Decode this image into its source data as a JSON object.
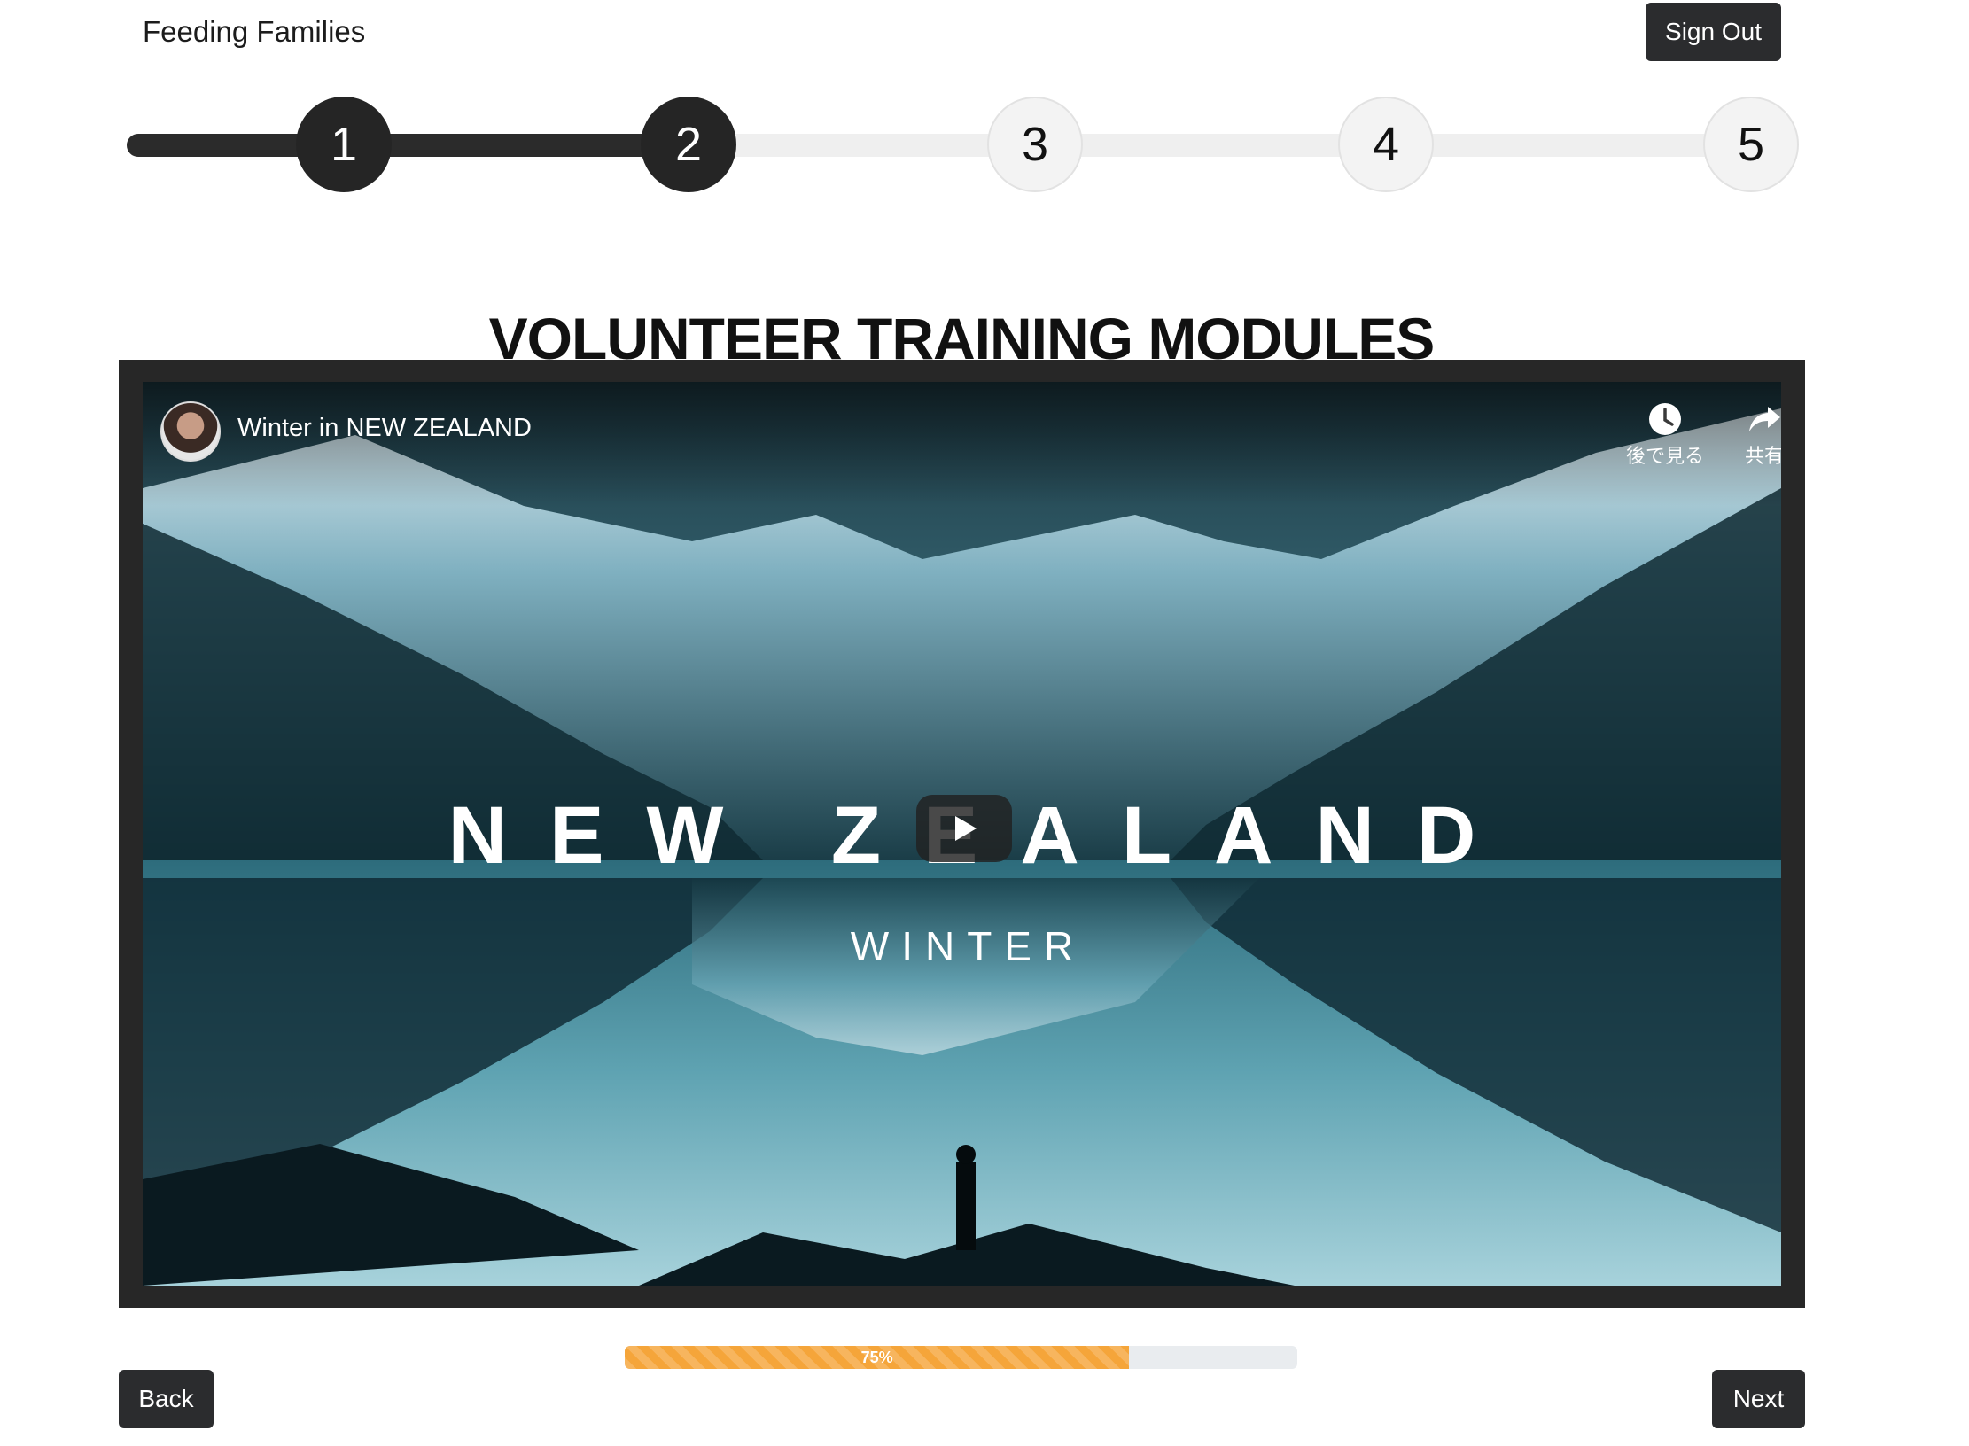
{
  "header": {
    "brand": "Feeding Families",
    "sign_out_label": "Sign Out"
  },
  "stepper": {
    "steps": [
      "1",
      "2",
      "3",
      "4",
      "5"
    ],
    "completed_through": 2,
    "active_step": 2,
    "colors": {
      "done": "#252525",
      "todo": "#f3f3f3"
    }
  },
  "page": {
    "title": "VOLUNTEER TRAINING MODULES"
  },
  "video": {
    "title": "Winter in NEW ZEALAND",
    "overlay_title": "NEW ZEALAND",
    "overlay_subtitle": "WINTER",
    "watch_later_label": "後で見る",
    "share_label": "共有",
    "icons": [
      "channel-avatar",
      "clock-icon",
      "share-icon",
      "play-icon"
    ]
  },
  "progress": {
    "value": 0.75,
    "label": "75%",
    "color": "#f5a53a"
  },
  "nav": {
    "back_label": "Back",
    "next_label": "Next"
  }
}
